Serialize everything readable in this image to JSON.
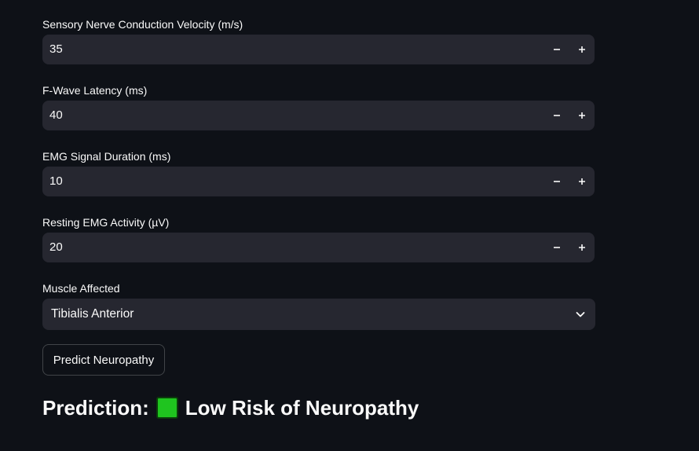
{
  "fields": [
    {
      "label": "Sensory Nerve Conduction Velocity (m/s)",
      "value": "35"
    },
    {
      "label": "F-Wave Latency (ms)",
      "value": "40"
    },
    {
      "label": "EMG Signal Duration (ms)",
      "value": "10"
    },
    {
      "label": "Resting EMG Activity (µV)",
      "value": "20"
    }
  ],
  "muscle": {
    "label": "Muscle Affected",
    "selected": "Tibialis Anterior"
  },
  "predict_button": "Predict Neuropathy",
  "prediction": {
    "label": "Prediction:",
    "result": "Low Risk of Neuropathy",
    "indicator_color": "#1fc41f",
    "indicator_icon": "green-square"
  }
}
